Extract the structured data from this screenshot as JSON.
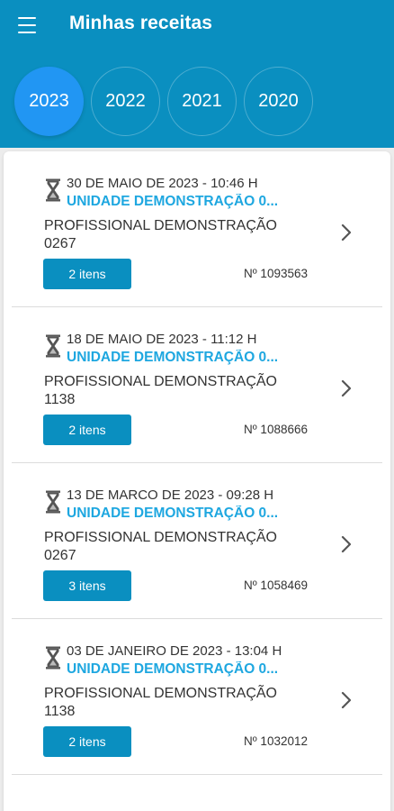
{
  "header": {
    "title": "Minhas receitas",
    "menu_icon": "hamburger-menu-icon",
    "years": [
      "2023",
      "2022",
      "2021",
      "2020"
    ],
    "selected_year": "2023"
  },
  "prescriptions": [
    {
      "date": "30 DE MAIO DE 2023 - 10:46 H",
      "unit": "UNIDADE DEMONSTRAÇÃO 0...",
      "professional": "PROFISSIONAL DEMONSTRAÇÃO 0267",
      "items_label": "2 itens",
      "number": "Nº 1093563"
    },
    {
      "date": "18 DE MAIO DE 2023 - 11:12 H",
      "unit": "UNIDADE DEMONSTRAÇÃO 0...",
      "professional": "PROFISSIONAL DEMONSTRAÇÃO 1138",
      "items_label": "2 itens",
      "number": "Nº 1088666"
    },
    {
      "date": "13 DE MARCO DE 2023 - 09:28 H",
      "unit": "UNIDADE DEMONSTRAÇÃO 0...",
      "professional": "PROFISSIONAL DEMONSTRAÇÃO 0267",
      "items_label": "3 itens",
      "number": "Nº 1058469"
    },
    {
      "date": "03 DE JANEIRO DE 2023 - 13:04 H",
      "unit": "UNIDADE DEMONSTRAÇÃO 0...",
      "professional": "PROFISSIONAL DEMONSTRAÇÃO 1138",
      "items_label": "2 itens",
      "number": "Nº 1032012"
    }
  ],
  "colors": {
    "header_bg": "#0a8fc0",
    "active_year": "#2196f3",
    "unit_text": "#1ea7e0",
    "button_bg": "#0a8fc0"
  }
}
